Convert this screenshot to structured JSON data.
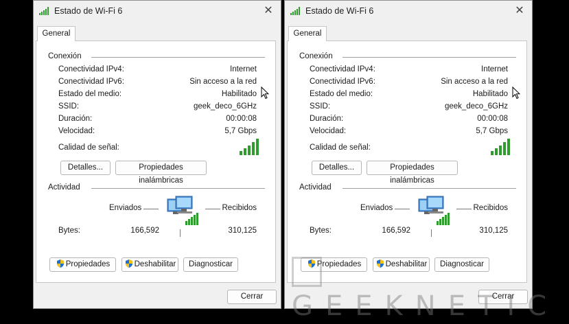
{
  "windows": [
    {
      "title": "Estado de Wi-Fi 6",
      "close_glyph": "✕",
      "tab": "General",
      "conexion": {
        "title": "Conexión",
        "rows": [
          {
            "label": "Conectividad IPv4:",
            "value": "Internet"
          },
          {
            "label": "Conectividad IPv6:",
            "value": "Sin acceso a la red"
          },
          {
            "label": "Estado del medio:",
            "value": "Habilitado"
          },
          {
            "label": "SSID:",
            "value": "geek_deco_6GHz"
          },
          {
            "label": "Duración:",
            "value": "00:00:08"
          },
          {
            "label": "Velocidad:",
            "value": "5,7 Gbps"
          }
        ],
        "signal_label": "Calidad de señal:",
        "signal_bars": 5,
        "details_button": "Detalles...",
        "wireless_props_button": "Propiedades inalámbricas"
      },
      "actividad": {
        "title": "Actividad",
        "sent_label": "Enviados",
        "received_label": "Recibidos",
        "bytes_label": "Bytes:",
        "bytes_sent": "166,592",
        "bytes_received": "310,125"
      },
      "buttons": {
        "properties": "Propiedades",
        "disable": "Deshabilitar",
        "diagnose": "Diagnosticar"
      },
      "close_button": "Cerrar"
    },
    {
      "title": "Estado de Wi-Fi 6",
      "close_glyph": "✕",
      "tab": "General",
      "conexion": {
        "title": "Conexión",
        "rows": [
          {
            "label": "Conectividad IPv4:",
            "value": "Internet"
          },
          {
            "label": "Conectividad IPv6:",
            "value": "Sin acceso a la red"
          },
          {
            "label": "Estado del medio:",
            "value": "Habilitado"
          },
          {
            "label": "SSID:",
            "value": "geek_deco_6GHz"
          },
          {
            "label": "Duración:",
            "value": "00:00:08"
          },
          {
            "label": "Velocidad:",
            "value": "5,7 Gbps"
          }
        ],
        "signal_label": "Calidad de señal:",
        "signal_bars": 5,
        "details_button": "Detalles...",
        "wireless_props_button": "Propiedades inalámbricas"
      },
      "actividad": {
        "title": "Actividad",
        "sent_label": "Enviados",
        "received_label": "Recibidos",
        "bytes_label": "Bytes:",
        "bytes_sent": "166,592",
        "bytes_received": "310,125"
      },
      "buttons": {
        "properties": "Propiedades",
        "disable": "Deshabilitar",
        "diagnose": "Diagnosticar"
      },
      "close_button": "Cerrar"
    }
  ],
  "watermark": "GEEKNETIC",
  "colors": {
    "signal_green": "#2e9d2e",
    "shield_blue": "#1e6fd0",
    "shield_yellow": "#f2c21b"
  }
}
